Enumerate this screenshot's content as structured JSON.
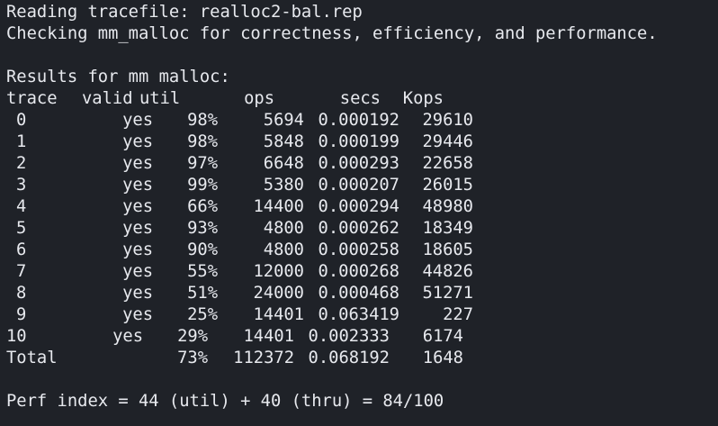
{
  "terminal": {
    "line1": "Reading tracefile: realloc2-bal.rep",
    "line2": "Checking mm_malloc for correctness, efficiency, and performance.",
    "results_heading": "Results for mm malloc:",
    "headers": {
      "trace": "trace",
      "valid": "valid",
      "util": "util",
      "ops": "ops",
      "secs": "secs",
      "kops": "Kops"
    },
    "rows": [
      {
        "trace": "0",
        "valid": "yes",
        "util": "98%",
        "ops": "5694",
        "secs": "0.000192",
        "kops": "29610"
      },
      {
        "trace": "1",
        "valid": "yes",
        "util": "98%",
        "ops": "5848",
        "secs": "0.000199",
        "kops": "29446"
      },
      {
        "trace": "2",
        "valid": "yes",
        "util": "97%",
        "ops": "6648",
        "secs": "0.000293",
        "kops": "22658"
      },
      {
        "trace": "3",
        "valid": "yes",
        "util": "99%",
        "ops": "5380",
        "secs": "0.000207",
        "kops": "26015"
      },
      {
        "trace": "4",
        "valid": "yes",
        "util": "66%",
        "ops": "14400",
        "secs": "0.000294",
        "kops": "48980"
      },
      {
        "trace": "5",
        "valid": "yes",
        "util": "93%",
        "ops": "4800",
        "secs": "0.000262",
        "kops": "18349"
      },
      {
        "trace": "6",
        "valid": "yes",
        "util": "90%",
        "ops": "4800",
        "secs": "0.000258",
        "kops": "18605"
      },
      {
        "trace": "7",
        "valid": "yes",
        "util": "55%",
        "ops": "12000",
        "secs": "0.000268",
        "kops": "44826"
      },
      {
        "trace": "8",
        "valid": "yes",
        "util": "51%",
        "ops": "24000",
        "secs": "0.000468",
        "kops": "51271"
      },
      {
        "trace": "9",
        "valid": "yes",
        "util": "25%",
        "ops": "14401",
        "secs": "0.063419",
        "kops": "227"
      },
      {
        "trace": "10",
        "valid": "yes",
        "util": "29%",
        "ops": "14401",
        "secs": "0.002333",
        "kops": "6174"
      }
    ],
    "total": {
      "label": "Total",
      "util": "73%",
      "ops": "112372",
      "secs": "0.068192",
      "kops": "1648"
    },
    "perf_line": "Perf index = 44 (util) + 40 (thru) = 84/100"
  }
}
